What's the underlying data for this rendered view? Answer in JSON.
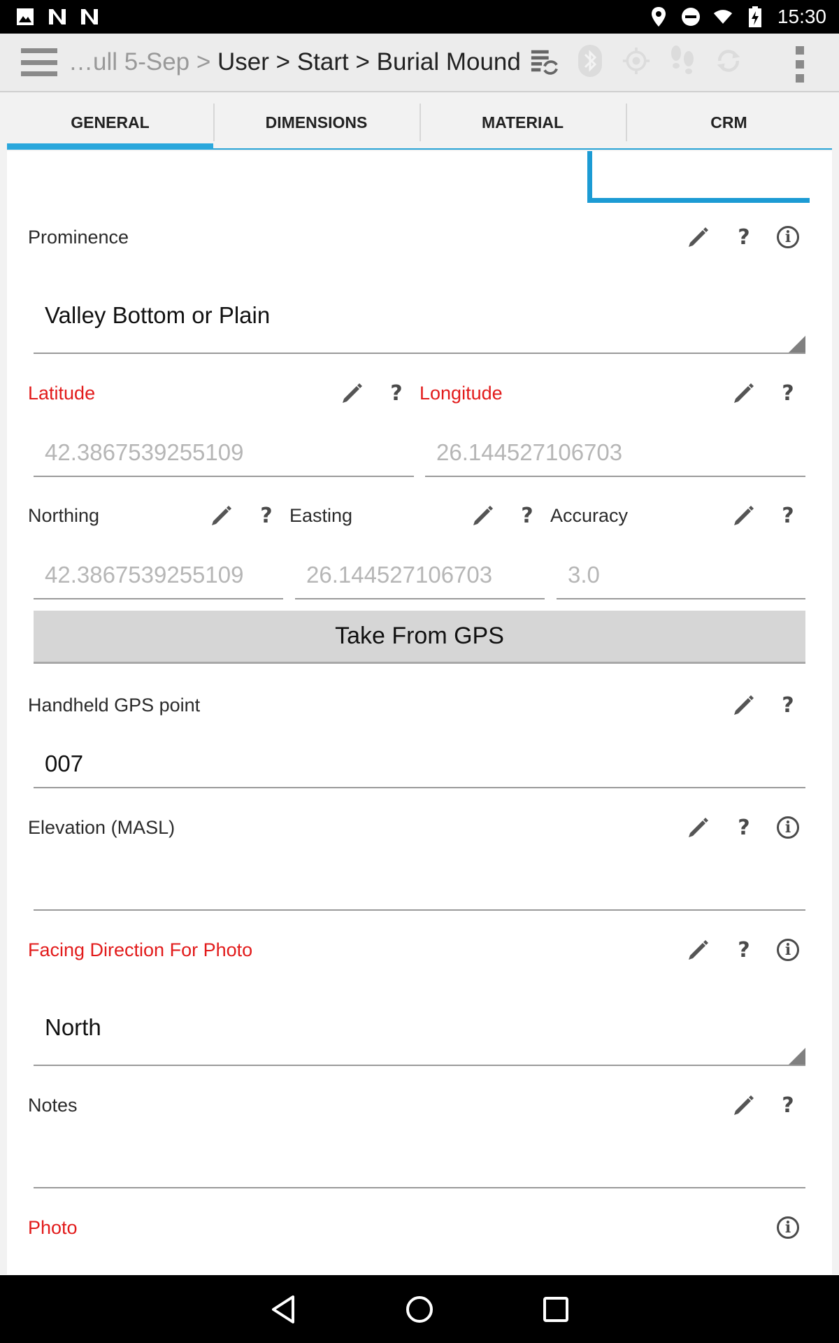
{
  "status_bar": {
    "time": "15:30",
    "left_icons": [
      "image-icon",
      "n-icon",
      "n-icon"
    ],
    "right_icons": [
      "location-icon",
      "do-not-disturb-icon",
      "wifi-icon",
      "battery-charging-icon"
    ]
  },
  "toolbar": {
    "breadcrumb_prefix": "…ull 5-Sep > ",
    "breadcrumb_path": "User > Start > Burial Mound",
    "icons": [
      "sync-list-icon",
      "bluetooth-icon",
      "gps-target-icon",
      "footsteps-icon",
      "refresh-icon"
    ]
  },
  "tabs": [
    {
      "label": "GENERAL",
      "active": true
    },
    {
      "label": "DIMENSIONS",
      "active": false
    },
    {
      "label": "MATERIAL",
      "active": false
    },
    {
      "label": "CRM",
      "active": false
    }
  ],
  "form": {
    "prominence": {
      "label": "Prominence",
      "value": "Valley Bottom or Plain"
    },
    "latitude": {
      "label": "Latitude",
      "placeholder": "42.3867539255109"
    },
    "longitude": {
      "label": "Longitude",
      "placeholder": "26.144527106703"
    },
    "northing": {
      "label": "Northing",
      "placeholder": "42.3867539255109"
    },
    "easting": {
      "label": "Easting",
      "placeholder": "26.144527106703"
    },
    "accuracy": {
      "label": "Accuracy",
      "placeholder": "3.0"
    },
    "take_gps_label": "Take From GPS",
    "handheld_gps": {
      "label": "Handheld GPS point",
      "value": "007"
    },
    "elevation": {
      "label": "Elevation (MASL)",
      "value": ""
    },
    "facing_direction": {
      "label": "Facing Direction For Photo",
      "value": "North"
    },
    "notes": {
      "label": "Notes",
      "value": ""
    },
    "photo": {
      "label": "Photo"
    }
  },
  "glyphs": {
    "help": "?",
    "info": "i"
  },
  "colors": {
    "accent": "#2aa7dc",
    "required": "#e21b1b"
  }
}
